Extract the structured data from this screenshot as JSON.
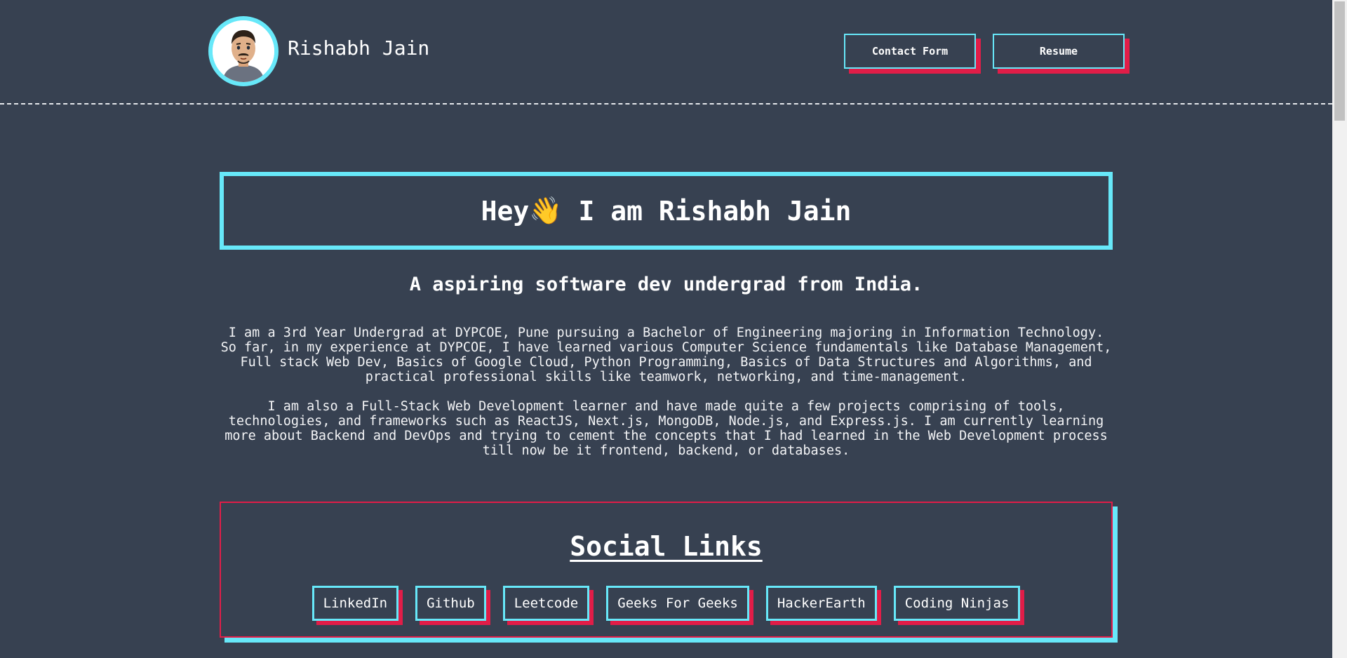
{
  "header": {
    "name": "Rishabh Jain",
    "contact_label": "Contact Form",
    "resume_label": "Resume",
    "avatar_icon": "profile-avatar"
  },
  "hero": {
    "greeting_prefix": "Hey",
    "wave_emoji": "👋",
    "greeting_suffix": " I am Rishabh Jain",
    "subtitle": "A aspiring software dev undergrad from India.",
    "paragraph1": "I am a 3rd Year Undergrad at DYPCOE, Pune pursuing a Bachelor of Engineering majoring in Information Technology. So far, in my experience at DYPCOE, I have learned various Computer Science fundamentals like Database Management, Full stack Web Dev, Basics of Google Cloud, Python Programming, Basics of Data Structures and Algorithms, and practical professional skills like teamwork, networking, and time-management.",
    "paragraph2": "I am also a Full-Stack Web Development learner and have made quite a few projects comprising of tools, technologies, and frameworks such as ReactJS, Next.js, MongoDB, Node.js, and Express.js. I am currently learning more about Backend and DevOps and trying to cement the concepts that I had learned in the Web Development process till now be it frontend, backend, or databases."
  },
  "social": {
    "title": "Social Links",
    "links": [
      "LinkedIn",
      "Github",
      "Leetcode",
      "Geeks For Geeks",
      "HackerEarth",
      "Coding Ninjas"
    ]
  },
  "colors": {
    "background": "#374151",
    "accent_cyan": "#67e8f9",
    "accent_red": "#e11d48"
  }
}
